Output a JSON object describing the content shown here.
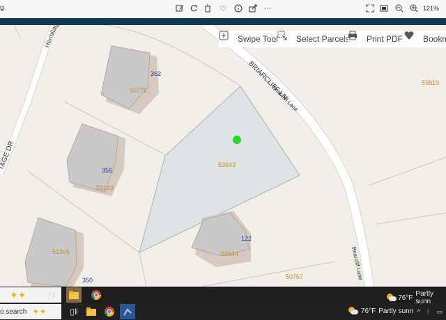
{
  "viewer": {
    "left_fragment": "g",
    "zoom": "121%"
  },
  "map": {
    "tools": {
      "swipe": "Swipe Tool",
      "select": "Select Parcels",
      "print": "Print PDF",
      "bookmark": "Bookm"
    },
    "streets": {
      "hermitage_ln": "Hermitage L",
      "hermitage_dr": "TAGE DR",
      "briarcliff_upper": "BRIARCLIFF LN",
      "briarcliff_lane_1": "Briarcliff Lane",
      "briarcliff_lane_2": "Briarcliff Lane"
    },
    "parcels": {
      "p50776": "50776",
      "p53163": "53163",
      "p53643": "53643",
      "p51905": "51905",
      "p53644": "53644",
      "p50757": "50757",
      "p59819": "59819"
    },
    "addresses": {
      "a362": "362",
      "a356": "356",
      "a122": "122",
      "a350": "350"
    }
  },
  "taskbar": {
    "search_placeholder": "o search",
    "weather_temp": "76°F",
    "weather_desc_top": "Partly sunn",
    "weather_desc_bottom": "Partly sunn",
    "icons": [
      "task-view-icon",
      "file-explorer-icon",
      "chrome-icon",
      "app-icon"
    ]
  }
}
